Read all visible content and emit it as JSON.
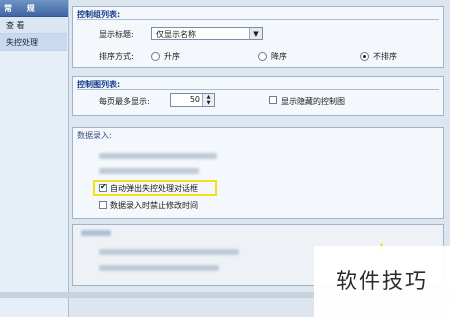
{
  "sidebar": {
    "header_label": "常 规",
    "items": [
      {
        "label": "查 看"
      },
      {
        "label": "失控处理"
      }
    ]
  },
  "group_options": {
    "title": "控制组列表:",
    "display_title_label": "显示标题:",
    "display_title_value": "仅显示名称",
    "sort_label": "排序方式:",
    "sort_options": [
      {
        "label": "升序",
        "selected": false
      },
      {
        "label": "降序",
        "selected": false
      },
      {
        "label": "不排序",
        "selected": true
      }
    ]
  },
  "chart_list": {
    "title": "控制图列表:",
    "per_page_label": "每页最多显示:",
    "per_page_value": "50",
    "show_hidden_label": "显示隐藏的控制图",
    "show_hidden_checked": false
  },
  "data_entry": {
    "title": "数据录入:",
    "auto_popup_label": "自动弹出失控处理对话框",
    "auto_popup_checked": true,
    "forbid_edit_label": "数据录入时禁止修改时间",
    "forbid_edit_checked": false
  },
  "watermark": {
    "text": "软件技巧"
  },
  "colors": {
    "accent": "#153d8a",
    "highlight": "#f2e01c"
  }
}
